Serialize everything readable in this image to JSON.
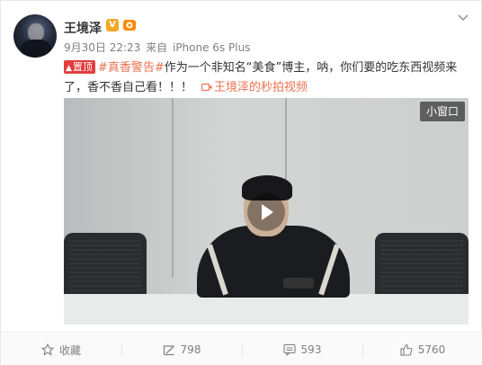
{
  "post": {
    "author": "王境泽",
    "verified_badge": "V",
    "date": "9月30日 22:23",
    "source_prefix": "来自",
    "source_device": "iPhone 6s Plus",
    "pin_label": "置顶",
    "topic": "#真香警告#",
    "text": "作为一个非知名“美食”博主，呐，你们要的吃东西视频来了，香不香自己看！！！",
    "video_link": "王境泽的秒拍视频"
  },
  "video": {
    "mini_window_label": "小窗口"
  },
  "actions": {
    "favorite_label": "收藏",
    "repost_count": "798",
    "comment_count": "593",
    "like_count": "5760"
  },
  "colors": {
    "accent_link": "#eb7350",
    "pin_red": "#e13d3d",
    "meta_gray": "#808080",
    "badge_gold": "#f5a623"
  },
  "icons": {
    "avatar": "user-avatar",
    "verified": "verified-v-icon",
    "rank": "level-badge-icon",
    "menu": "chevron-down-icon",
    "video_link": "video-link-icon",
    "play": "play-icon",
    "favorite": "star-icon",
    "repost": "repost-icon",
    "comment": "comment-icon",
    "like": "thumbs-up-icon"
  }
}
